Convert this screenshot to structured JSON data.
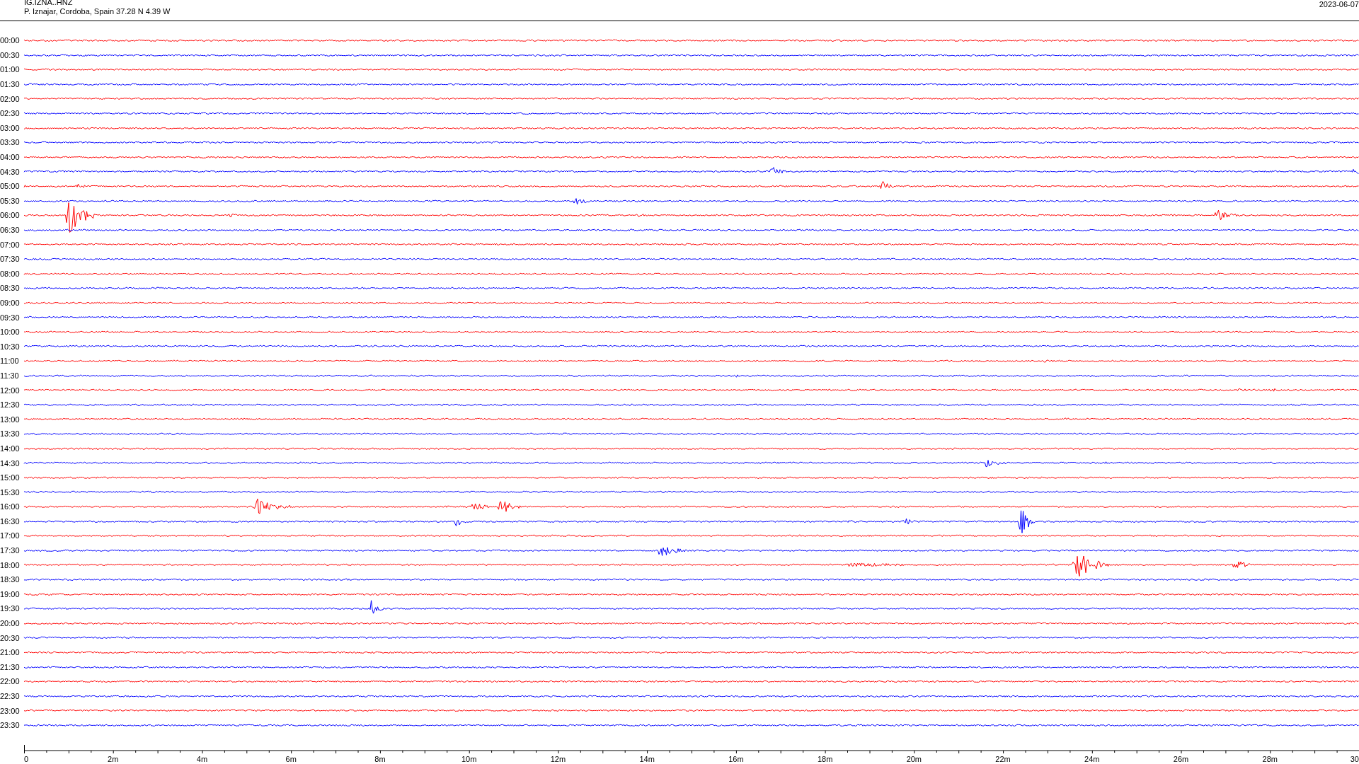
{
  "header": {
    "station": "IG.IZNA..HNZ",
    "location": "P. Iznajar, Cordoba, Spain  37.28 N 4.39 W",
    "date": "2023-06-07"
  },
  "traces": [
    {
      "label": "00:00",
      "color": "#ff0000"
    },
    {
      "label": "00:30",
      "color": "#0000ff"
    },
    {
      "label": "01:00",
      "color": "#ff0000"
    },
    {
      "label": "01:30",
      "color": "#0000ff"
    },
    {
      "label": "02:00",
      "color": "#ff0000"
    },
    {
      "label": "02:30",
      "color": "#0000ff"
    },
    {
      "label": "03:00",
      "color": "#ff0000"
    },
    {
      "label": "03:30",
      "color": "#0000ff"
    },
    {
      "label": "04:00",
      "color": "#ff0000"
    },
    {
      "label": "04:30",
      "color": "#0000ff"
    },
    {
      "label": "05:00",
      "color": "#ff0000"
    },
    {
      "label": "05:30",
      "color": "#0000ff"
    },
    {
      "label": "06:00",
      "color": "#ff0000"
    },
    {
      "label": "06:30",
      "color": "#0000ff"
    },
    {
      "label": "07:00",
      "color": "#ff0000"
    },
    {
      "label": "07:30",
      "color": "#0000ff"
    },
    {
      "label": "08:00",
      "color": "#ff0000"
    },
    {
      "label": "08:30",
      "color": "#0000ff"
    },
    {
      "label": "09:00",
      "color": "#ff0000"
    },
    {
      "label": "09:30",
      "color": "#0000ff"
    },
    {
      "label": "10:00",
      "color": "#ff0000"
    },
    {
      "label": "10:30",
      "color": "#0000ff"
    },
    {
      "label": "11:00",
      "color": "#ff0000"
    },
    {
      "label": "11:30",
      "color": "#0000ff"
    },
    {
      "label": "12:00",
      "color": "#ff0000"
    },
    {
      "label": "12:30",
      "color": "#0000ff"
    },
    {
      "label": "13:00",
      "color": "#ff0000"
    },
    {
      "label": "13:30",
      "color": "#0000ff"
    },
    {
      "label": "14:00",
      "color": "#ff0000"
    },
    {
      "label": "14:30",
      "color": "#0000ff"
    },
    {
      "label": "15:00",
      "color": "#ff0000"
    },
    {
      "label": "15:30",
      "color": "#0000ff"
    },
    {
      "label": "16:00",
      "color": "#ff0000"
    },
    {
      "label": "16:30",
      "color": "#0000ff"
    },
    {
      "label": "17:00",
      "color": "#ff0000"
    },
    {
      "label": "17:30",
      "color": "#0000ff"
    },
    {
      "label": "18:00",
      "color": "#ff0000"
    },
    {
      "label": "18:30",
      "color": "#0000ff"
    },
    {
      "label": "19:00",
      "color": "#ff0000"
    },
    {
      "label": "19:30",
      "color": "#0000ff"
    },
    {
      "label": "20:00",
      "color": "#ff0000"
    },
    {
      "label": "20:30",
      "color": "#0000ff"
    },
    {
      "label": "21:00",
      "color": "#ff0000"
    },
    {
      "label": "21:30",
      "color": "#0000ff"
    },
    {
      "label": "22:00",
      "color": "#ff0000"
    },
    {
      "label": "22:30",
      "color": "#0000ff"
    },
    {
      "label": "23:00",
      "color": "#ff0000"
    },
    {
      "label": "23:30",
      "color": "#0000ff"
    }
  ],
  "x_axis": {
    "ticks": [
      "0",
      "2m",
      "4m",
      "6m",
      "8m",
      "10m",
      "12m",
      "14m",
      "16m",
      "18m",
      "20m",
      "22m",
      "24m",
      "26m",
      "28m",
      "30"
    ]
  }
}
